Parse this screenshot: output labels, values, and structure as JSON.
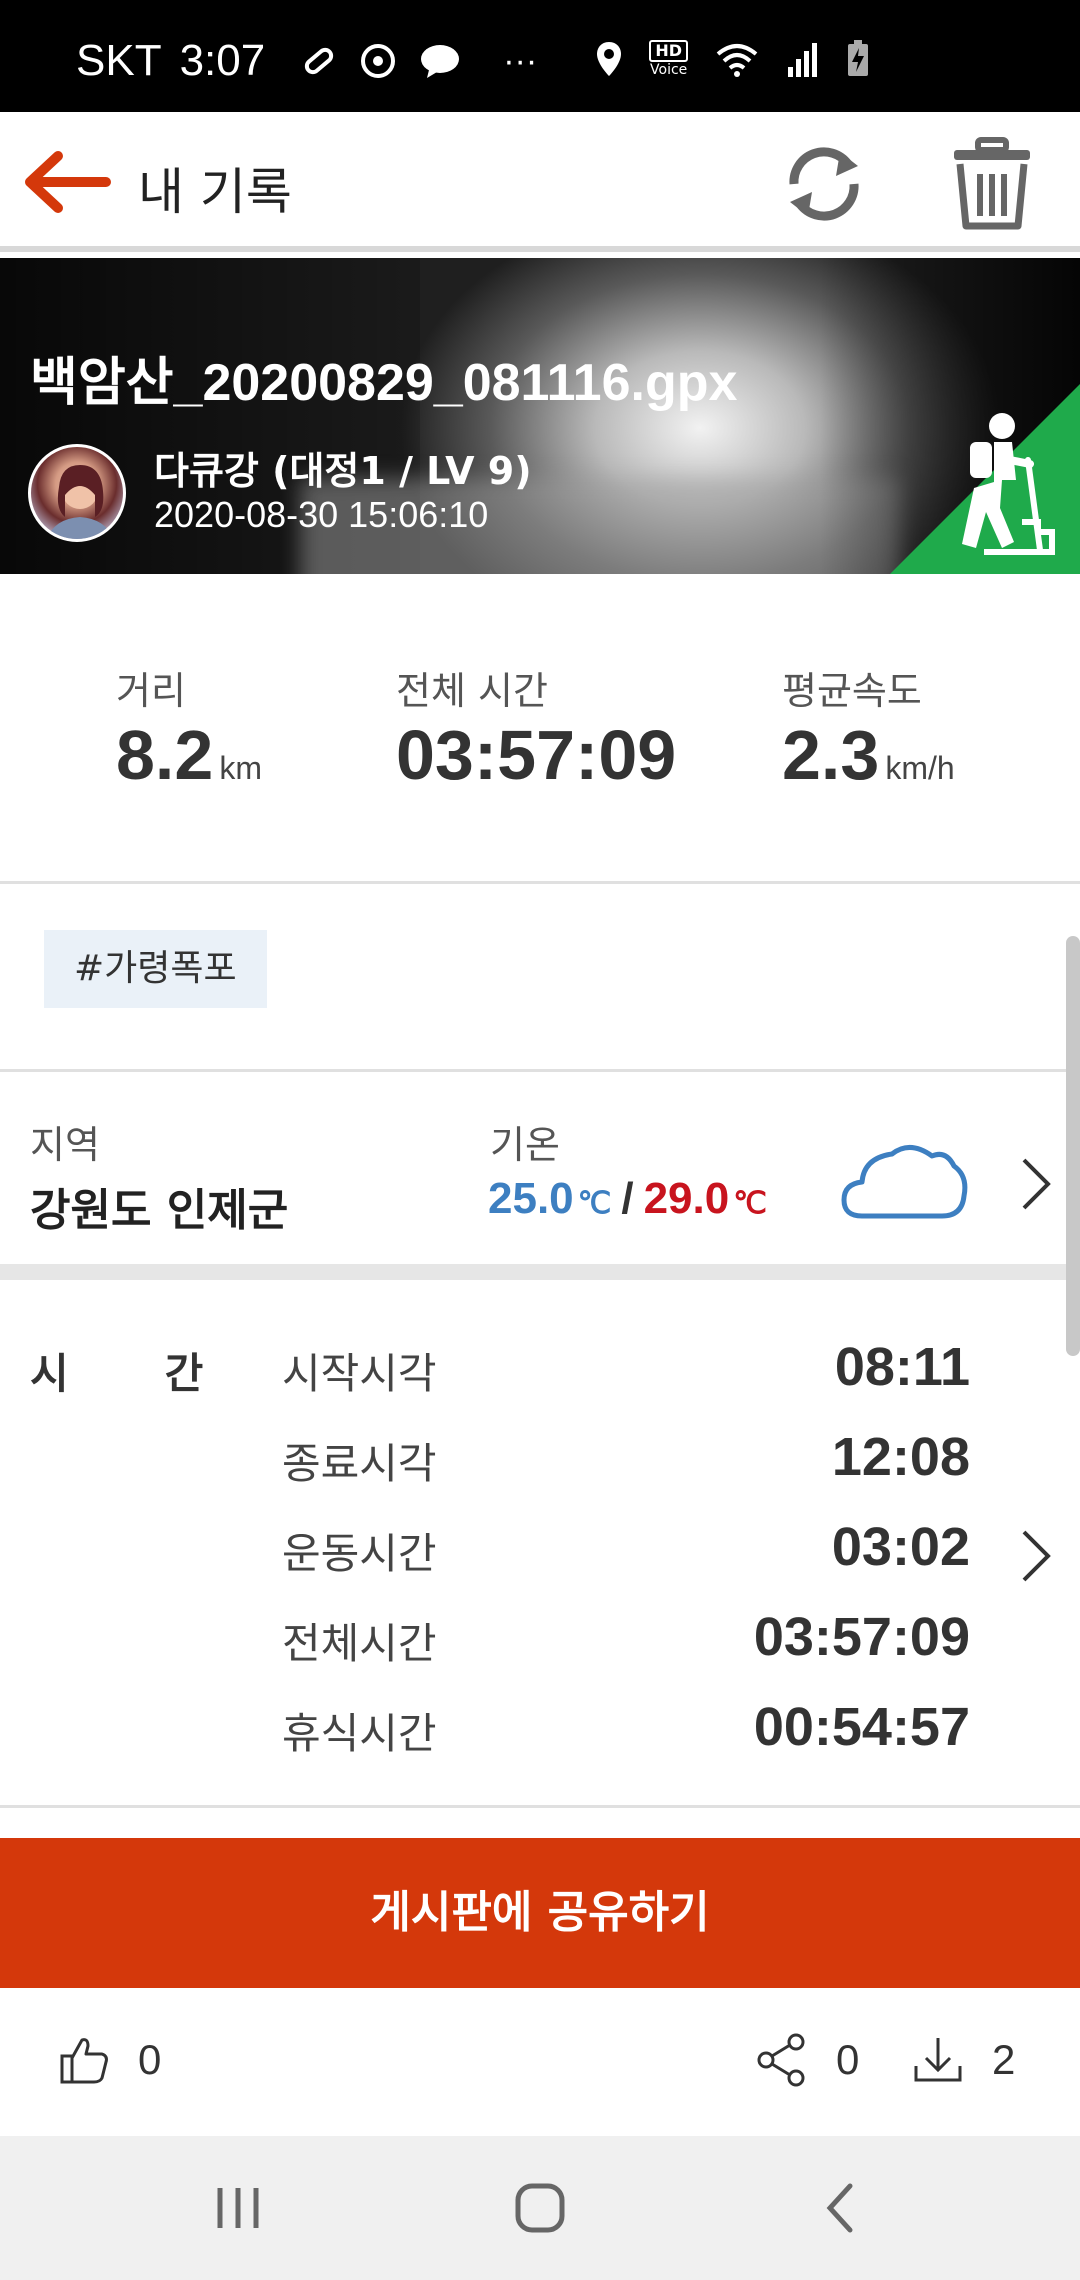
{
  "status_bar": {
    "carrier": "SKT",
    "time": "3:07",
    "more": "···",
    "hd_label": "HD",
    "voice_label": "Voice"
  },
  "app_bar": {
    "title": "내 기록"
  },
  "record": {
    "file_name": "백암산_20200829_081116.gpx",
    "user_name": "다큐강 (대정1 / LV 9)",
    "datetime": "2020-08-30 15:06:10"
  },
  "stats": {
    "distance": {
      "label": "거리",
      "value": "8.2",
      "unit": "km"
    },
    "total_time": {
      "label": "전체 시간",
      "value": "03:57:09"
    },
    "avg_speed": {
      "label": "평균속도",
      "value": "2.3",
      "unit": "km/h"
    }
  },
  "tags": [
    "#가령폭포"
  ],
  "region": {
    "label": "지역",
    "value": "강원도 인제군"
  },
  "weather": {
    "label": "기온",
    "low": "25.0",
    "high": "29.0",
    "unit": "℃",
    "separator": "/",
    "low_color": "#3d7fc1",
    "high_color": "#c8141e",
    "icon": "cloud-icon"
  },
  "times": {
    "section_label": "시간",
    "rows": [
      {
        "label": "시작시각",
        "value": "08:11"
      },
      {
        "label": "종료시각",
        "value": "12:08"
      },
      {
        "label": "운동시간",
        "value": "03:02"
      },
      {
        "label": "전체시간",
        "value": "03:57:09"
      },
      {
        "label": "휴식시간",
        "value": "00:54:57"
      }
    ]
  },
  "share_button": {
    "label": "게시판에 공유하기",
    "color": "#d4380b"
  },
  "actions": {
    "likes": "0",
    "shares": "0",
    "downloads": "2"
  },
  "colors": {
    "accent": "#d4380b",
    "badge_green": "#1faa4b"
  }
}
